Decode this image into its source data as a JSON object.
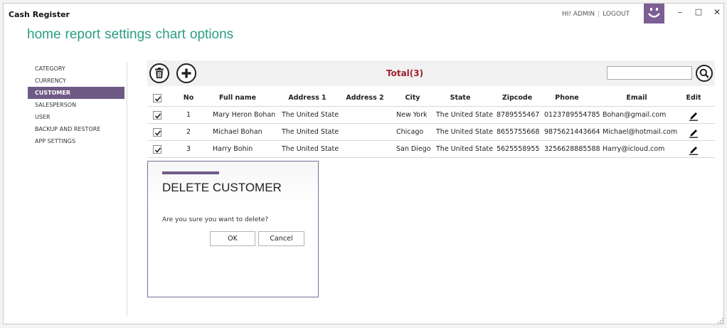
{
  "app": {
    "title": "Cash Register"
  },
  "user": {
    "greeting": "HI! ADMIN",
    "separator": "|",
    "logout": "LOGOUT"
  },
  "window_controls": {
    "minimize": "–",
    "maximize": "□",
    "close": "✕"
  },
  "nav": [
    {
      "label": "home"
    },
    {
      "label": "report"
    },
    {
      "label": "settings"
    },
    {
      "label": "chart"
    },
    {
      "label": "options"
    }
  ],
  "sidebar": {
    "items": [
      {
        "label": "CATEGORY",
        "active": false
      },
      {
        "label": "CURRENCY",
        "active": false
      },
      {
        "label": "CUSTOMER",
        "active": true
      },
      {
        "label": "SALESPERSON",
        "active": false
      },
      {
        "label": "USER",
        "active": false
      },
      {
        "label": "BACKUP AND RESTORE",
        "active": false
      },
      {
        "label": "APP SETTINGS",
        "active": false
      }
    ]
  },
  "toolbar": {
    "total": "Total(3)",
    "search_value": "",
    "icons": {
      "delete": "trash-icon",
      "add": "plus-icon",
      "search": "search-icon"
    }
  },
  "table": {
    "headers": {
      "no": "No",
      "full_name": "Full name",
      "address1": "Address 1",
      "address2": "Address 2",
      "city": "City",
      "state": "State",
      "zipcode": "Zipcode",
      "phone": "Phone",
      "email": "Email",
      "edit": "Edit"
    },
    "rows": [
      {
        "checked": true,
        "no": "1",
        "full_name": "Mary Heron Bohan",
        "address1": "The United State",
        "address2": "",
        "city": "New York",
        "state": "The United State",
        "zipcode": "8789555467",
        "phone": "0123789554785",
        "email": "Bohan@gmail.com"
      },
      {
        "checked": true,
        "no": "2",
        "full_name": "Michael Bohan",
        "address1": "The United State",
        "address2": "",
        "city": "Chicago",
        "state": "The United State",
        "zipcode": "8655755668",
        "phone": "9875621443664",
        "email": "Michael@hotmail.com"
      },
      {
        "checked": true,
        "no": "3",
        "full_name": "Harry Bohin",
        "address1": "The United State",
        "address2": "",
        "city": "San Diego",
        "state": "The United State",
        "zipcode": "5625558955",
        "phone": "3256628885588",
        "email": "Harry@icloud.com"
      }
    ]
  },
  "dialog": {
    "title": "DELETE CUSTOMER",
    "message": "Are you sure you want to delete?",
    "ok_label": "OK",
    "cancel_label": "Cancel"
  },
  "colors": {
    "accent": "#6f5a86",
    "nav": "#2a9d85",
    "total": "#a22030",
    "smiley_bg": "#7d5f93"
  }
}
